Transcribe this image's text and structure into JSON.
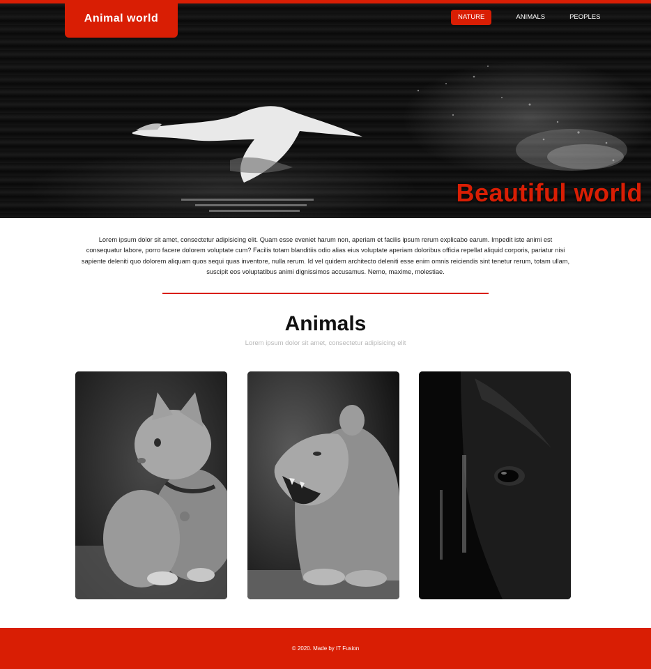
{
  "brand": {
    "logo_text": "Animal world",
    "accent_color": "#d91e04"
  },
  "nav": {
    "items": [
      {
        "label": "NATURE",
        "active": true
      },
      {
        "label": "ANIMALS",
        "active": false
      },
      {
        "label": "PEOPLES",
        "active": false
      }
    ]
  },
  "hero": {
    "headline": "Beautiful world",
    "image": "swan-flying-over-water"
  },
  "intro": {
    "text": "Lorem ipsum dolor sit amet, consectetur adipisicing elit. Quam esse eveniet harum non, aperiam et facilis ipsum rerum explicabo earum. Impedit iste animi est consequatur labore, porro facere dolorem voluptate cum? Facilis totam blanditiis odio alias eius voluptate aperiam doloribus officia repellat aliquid corporis, pariatur nisi sapiente deleniti quo dolorem aliquam quos sequi quas inventore, nulla rerum. Id vel quidem architecto deleniti esse enim omnis reiciendis sint tenetur rerum, totam ullam, suscipit eos voluptatibus animi dignissimos accusamus. Nemo, maxime, molestiae."
  },
  "animals": {
    "title": "Animals",
    "subtitle": "Lorem ipsum dolor sit amet, consectetur adipisicing elit",
    "cards": [
      {
        "image": "kitten-photo"
      },
      {
        "image": "lioness-roaring-photo"
      },
      {
        "image": "horse-head-photo"
      }
    ]
  },
  "footer": {
    "text": "© 2020. Made by IT Fusion"
  }
}
